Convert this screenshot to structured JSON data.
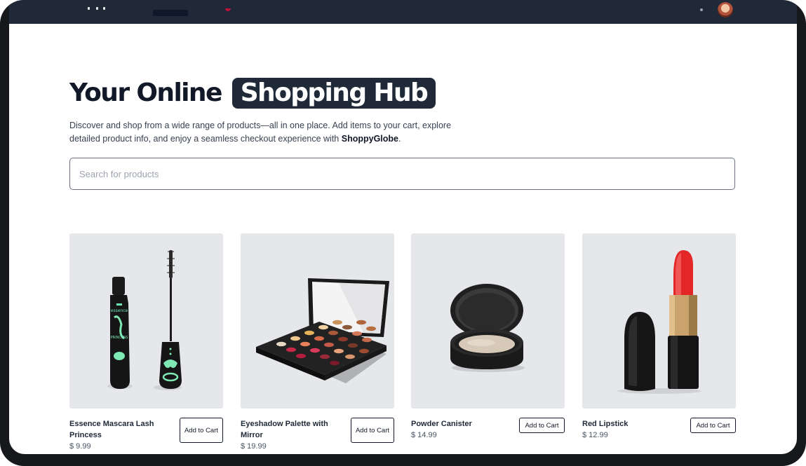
{
  "hero": {
    "title_plain": "Your Online",
    "title_highlight": "Shopping Hub",
    "desc_start": "Discover and shop from a wide range of products—all in one place. Add items to your cart, explore detailed product info, and enjoy a seamless checkout experience with ",
    "brand": "ShoppyGlobe",
    "desc_end": "."
  },
  "search": {
    "placeholder": "Search for products",
    "value": ""
  },
  "products": [
    {
      "name": "Essence Mascara Lash Princess",
      "price": "$ 9.99",
      "button": "Add to Cart",
      "image": "mascara-image"
    },
    {
      "name": "Eyeshadow Palette with Mirror",
      "price": "$ 19.99",
      "button": "Add to Cart",
      "image": "eyeshadow-palette-image"
    },
    {
      "name": "Powder Canister",
      "price": "$ 14.99",
      "button": "Add to Cart",
      "image": "powder-canister-image"
    },
    {
      "name": "Red Lipstick",
      "price": "$ 12.99",
      "button": "Add to Cart",
      "image": "lipstick-image"
    }
  ],
  "colors": {
    "navbar": "#1f2937",
    "highlight_bg": "#1f2937",
    "card_bg": "#e5e7eb",
    "text": "#111827",
    "frame": "#16181c"
  }
}
